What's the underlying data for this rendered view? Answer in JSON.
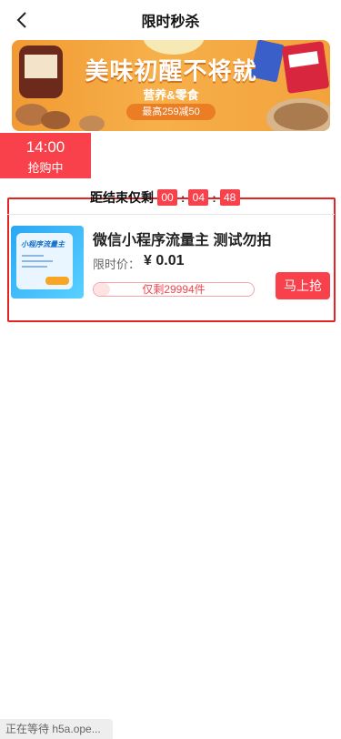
{
  "nav": {
    "title": "限时秒杀",
    "back_icon": "chevron-left-icon"
  },
  "banner": {
    "headline": "美味初醒不将就",
    "subtitle": "营养&零食",
    "promo": "最高259减50",
    "colors": {
      "bg": "#f29a33",
      "pill": "#eb7d25"
    }
  },
  "time_tab": {
    "time": "14:00",
    "status": "抢购中"
  },
  "countdown": {
    "label": "距结束仅剩",
    "hours": "00",
    "minutes": "04",
    "seconds": "48",
    "separator": ":"
  },
  "product": {
    "title": "微信小程序流量主 测试勿拍",
    "price_label": "限时价：",
    "price": "¥ 0.01",
    "stock_text": "仅剩29994件",
    "stock_fraction": 0.1,
    "buy_label": "马上抢",
    "image_caption": "小程序流量主"
  },
  "status_bar": {
    "text": "正在等待 h5a.ope..."
  },
  "colors": {
    "accent": "#f8414b",
    "highlight": "#e32424"
  }
}
